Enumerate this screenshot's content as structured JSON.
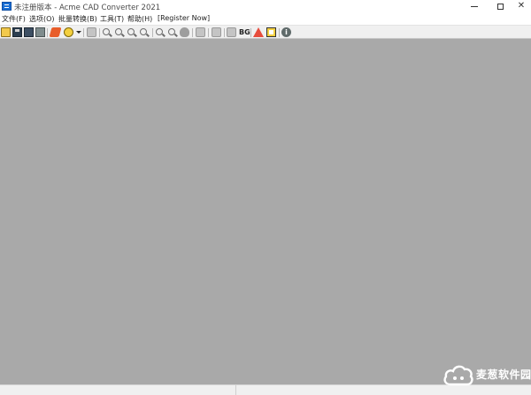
{
  "window": {
    "title": "未注册版本 - Acme CAD Converter 2021",
    "minimize_glyph": "—",
    "close_glyph": "✕"
  },
  "menu": {
    "items": [
      {
        "label": "文件(F)"
      },
      {
        "label": "选项(O)"
      },
      {
        "label": "批量转换(B)"
      },
      {
        "label": "工具(T)"
      },
      {
        "label": "帮助(H)"
      },
      {
        "label": "[Register Now]"
      }
    ]
  },
  "toolbar": {
    "bg_label": "BG",
    "info_glyph": "i",
    "icons": [
      "open-folder-icon",
      "save-icon",
      "save-as-icon",
      "print-icon",
      "convert-icon",
      "batch-convert-icon",
      "gray-print-icon",
      "zoom-out-icon",
      "zoom-in-icon",
      "zoom-window-icon",
      "zoom-extents-icon",
      "zoom-realtime-icon",
      "zoom-previous-icon",
      "pan-icon",
      "layers-icon",
      "copy-icon",
      "grid-icon",
      "background-icon",
      "warning-icon",
      "frame-icon",
      "info-icon"
    ]
  },
  "canvas": {
    "background_color": "#a9a9a9"
  },
  "watermark": {
    "text": "麦葱软件园"
  },
  "colors": {
    "canvas": "#a9a9a9",
    "toolbar": "#f0f0f0",
    "app_icon": "#1a6fd4"
  }
}
